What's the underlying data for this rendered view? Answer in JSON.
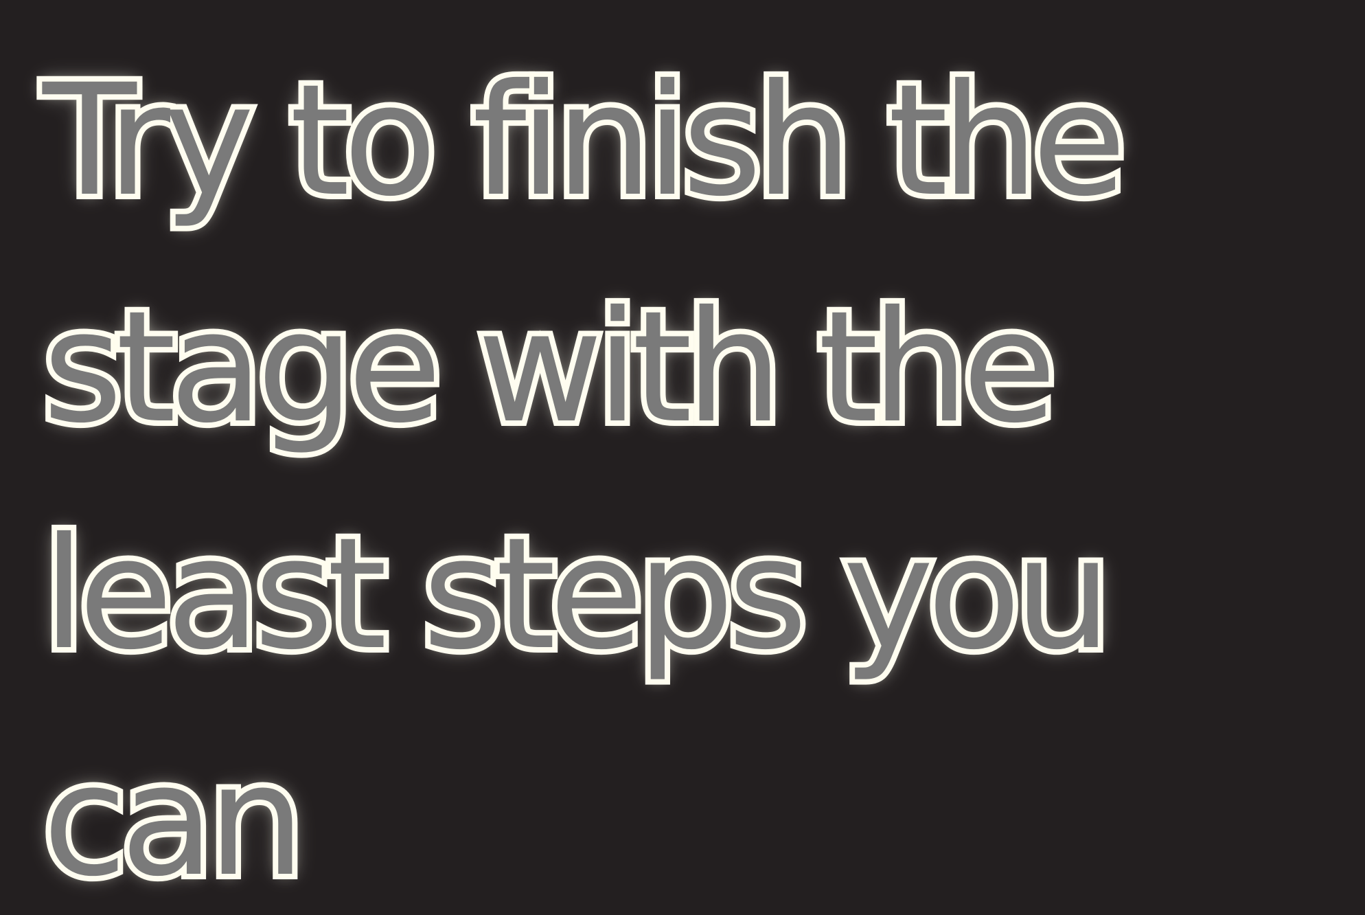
{
  "hint": {
    "lines": [
      "Try to finish the",
      "stage with the",
      "least steps you",
      "can"
    ]
  },
  "colors": {
    "background": "#231f20",
    "text_fill": "#7a7a7a",
    "text_outline": "#fffdf2",
    "glow": "#fffff0"
  }
}
